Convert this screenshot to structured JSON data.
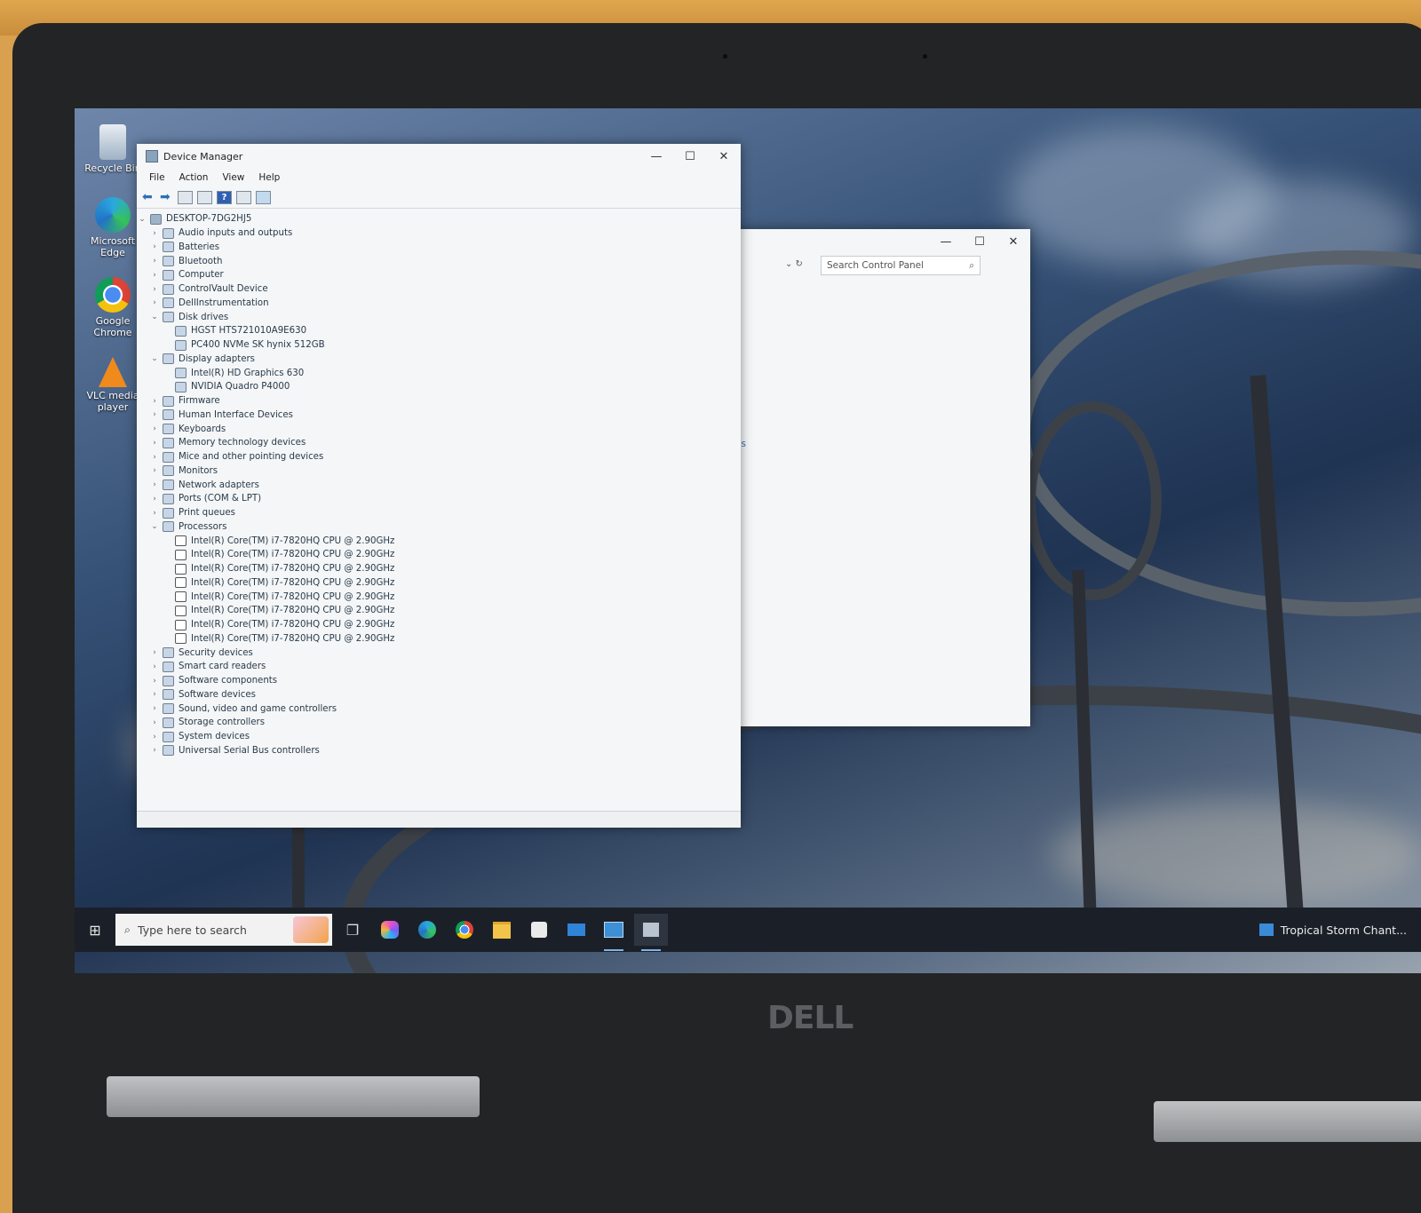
{
  "desktop": {
    "icons": [
      {
        "label": "Recycle Bin",
        "icon": "recycle-bin-icon"
      },
      {
        "label": "Microsoft Edge",
        "icon": "edge-icon"
      },
      {
        "label": "Google Chrome",
        "icon": "chrome-icon"
      },
      {
        "label": "VLC media player",
        "icon": "vlc-icon"
      }
    ]
  },
  "device_manager": {
    "title": "Device Manager",
    "menu": [
      "File",
      "Action",
      "View",
      "Help"
    ],
    "root": "DESKTOP-7DG2HJ5",
    "tree": [
      {
        "label": "Audio inputs and outputs",
        "expanded": false,
        "level": 1
      },
      {
        "label": "Batteries",
        "expanded": false,
        "level": 1
      },
      {
        "label": "Bluetooth",
        "expanded": false,
        "level": 1
      },
      {
        "label": "Computer",
        "expanded": false,
        "level": 1
      },
      {
        "label": "ControlVault Device",
        "expanded": false,
        "level": 1
      },
      {
        "label": "DellInstrumentation",
        "expanded": false,
        "level": 1
      },
      {
        "label": "Disk drives",
        "expanded": true,
        "level": 1
      },
      {
        "label": "HGST HTS721010A9E630",
        "level": 2
      },
      {
        "label": "PC400 NVMe SK hynix 512GB",
        "level": 2
      },
      {
        "label": "Display adapters",
        "expanded": true,
        "level": 1
      },
      {
        "label": "Intel(R) HD Graphics 630",
        "level": 2
      },
      {
        "label": "NVIDIA Quadro P4000",
        "level": 2
      },
      {
        "label": "Firmware",
        "expanded": false,
        "level": 1
      },
      {
        "label": "Human Interface Devices",
        "expanded": false,
        "level": 1
      },
      {
        "label": "Keyboards",
        "expanded": false,
        "level": 1
      },
      {
        "label": "Memory technology devices",
        "expanded": false,
        "level": 1
      },
      {
        "label": "Mice and other pointing devices",
        "expanded": false,
        "level": 1
      },
      {
        "label": "Monitors",
        "expanded": false,
        "level": 1
      },
      {
        "label": "Network adapters",
        "expanded": false,
        "level": 1
      },
      {
        "label": "Ports (COM & LPT)",
        "expanded": false,
        "level": 1
      },
      {
        "label": "Print queues",
        "expanded": false,
        "level": 1
      },
      {
        "label": "Processors",
        "expanded": true,
        "level": 1
      },
      {
        "label": "Intel(R) Core(TM) i7-7820HQ CPU @ 2.90GHz",
        "level": 2,
        "cpu": true
      },
      {
        "label": "Intel(R) Core(TM) i7-7820HQ CPU @ 2.90GHz",
        "level": 2,
        "cpu": true
      },
      {
        "label": "Intel(R) Core(TM) i7-7820HQ CPU @ 2.90GHz",
        "level": 2,
        "cpu": true
      },
      {
        "label": "Intel(R) Core(TM) i7-7820HQ CPU @ 2.90GHz",
        "level": 2,
        "cpu": true
      },
      {
        "label": "Intel(R) Core(TM) i7-7820HQ CPU @ 2.90GHz",
        "level": 2,
        "cpu": true
      },
      {
        "label": "Intel(R) Core(TM) i7-7820HQ CPU @ 2.90GHz",
        "level": 2,
        "cpu": true
      },
      {
        "label": "Intel(R) Core(TM) i7-7820HQ CPU @ 2.90GHz",
        "level": 2,
        "cpu": true
      },
      {
        "label": "Intel(R) Core(TM) i7-7820HQ CPU @ 2.90GHz",
        "level": 2,
        "cpu": true
      },
      {
        "label": "Security devices",
        "expanded": false,
        "level": 1
      },
      {
        "label": "Smart card readers",
        "expanded": false,
        "level": 1
      },
      {
        "label": "Software components",
        "expanded": false,
        "level": 1
      },
      {
        "label": "Software devices",
        "expanded": false,
        "level": 1
      },
      {
        "label": "Sound, video and game controllers",
        "expanded": false,
        "level": 1
      },
      {
        "label": "Storage controllers",
        "expanded": false,
        "level": 1
      },
      {
        "label": "System devices",
        "expanded": false,
        "level": 1
      },
      {
        "label": "Universal Serial Bus controllers",
        "expanded": false,
        "level": 1
      }
    ]
  },
  "control_panel": {
    "search_placeholder": "Search Control Panel",
    "partial_link": "leeps"
  },
  "taskbar": {
    "search_text": "Type here to search",
    "apps": [
      "task-view-icon",
      "copilot-icon",
      "edge-icon",
      "chrome-icon",
      "file-explorer-icon",
      "store-icon",
      "mail-icon",
      "control-panel-icon",
      "device-manager-icon"
    ],
    "news": "Tropical Storm Chant..."
  },
  "hardware": {
    "brand": "DELL"
  },
  "colors": {
    "taskbar": "#1b2028",
    "window_bg": "#f4f6f7",
    "accent": "#2d6fb4"
  }
}
